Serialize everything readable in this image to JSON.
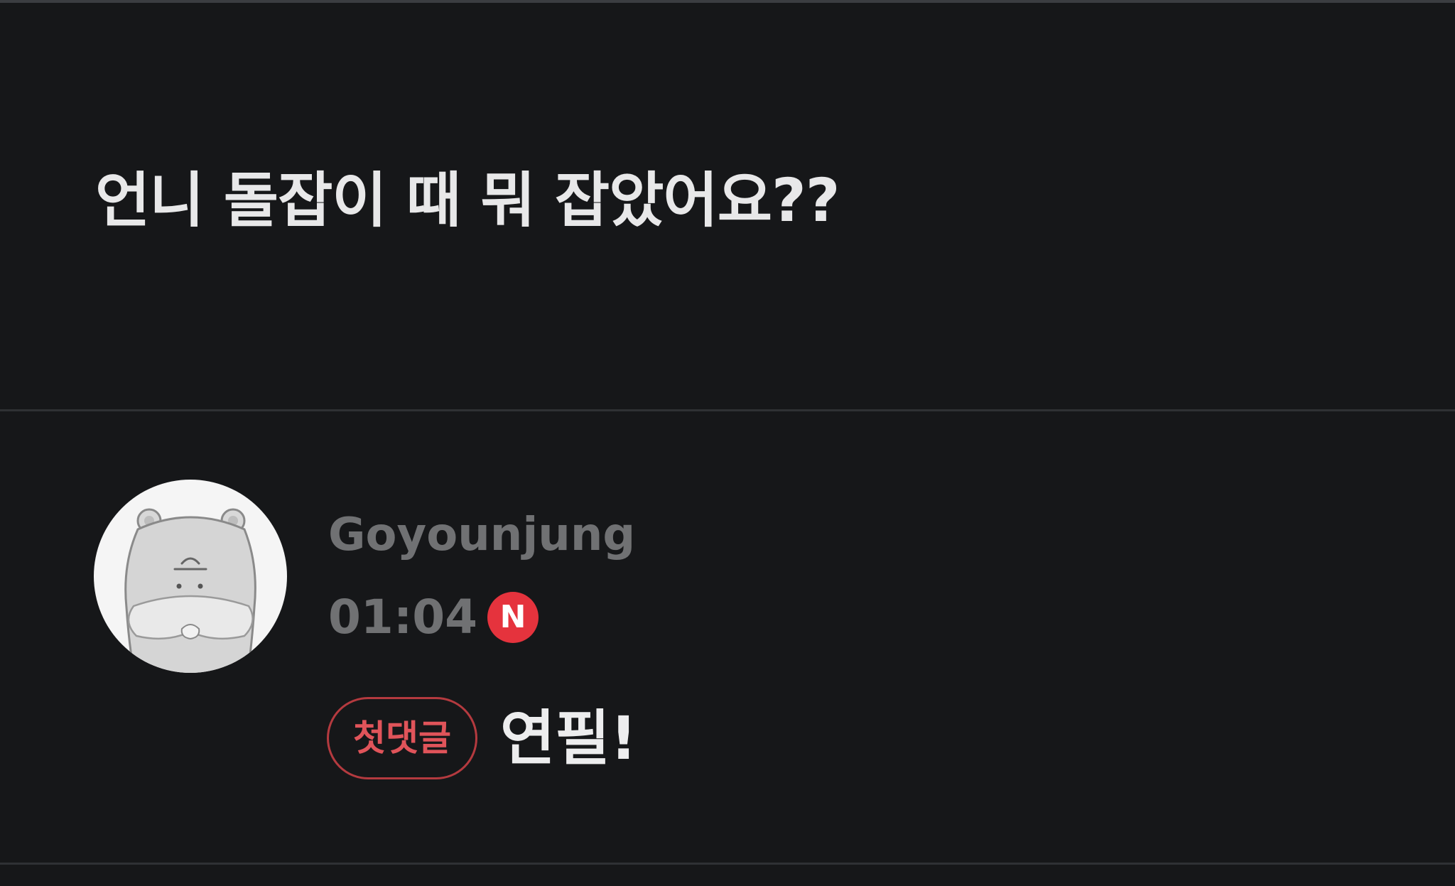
{
  "post": {
    "title": "언니 돌잡이 때 뭐 잡았어요??"
  },
  "comment": {
    "author": "Goyounjung",
    "time": "01:04",
    "new_badge": "N",
    "first_comment_badge": "첫댓글",
    "text": "연필!",
    "avatar_icon": "hamster-avatar-icon"
  },
  "colors": {
    "background": "#161719",
    "new_badge": "#e5333d",
    "first_comment_border": "#b43a3f",
    "first_comment_text": "#e0545a",
    "meta_text": "#707173",
    "primary_text": "#e8e8e9"
  }
}
